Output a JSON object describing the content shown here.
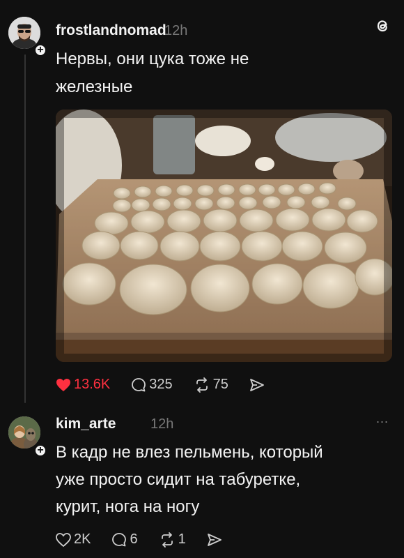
{
  "post": {
    "username": "frostlandnomad",
    "time": "12h",
    "text_line1": "Нервы, они цука тоже не",
    "text_line2": "железные",
    "likes": "13.6K",
    "comments": "325",
    "reposts": "75"
  },
  "reply": {
    "username": "kim_arte",
    "time": "12h",
    "more_label": "...",
    "text_line1": "В кадр не влез пельмень, который",
    "text_line2": "уже просто сидит на табуретке,",
    "text_line3": "курит, нога на ногу",
    "likes": "2K",
    "comments": "6",
    "reposts": "1"
  },
  "colors": {
    "background": "#101010",
    "like_active": "#ff3040",
    "muted": "#777777"
  },
  "icons": [
    "threads-logo-icon",
    "heart-icon",
    "comment-icon",
    "repost-icon",
    "share-icon",
    "plus-icon"
  ]
}
